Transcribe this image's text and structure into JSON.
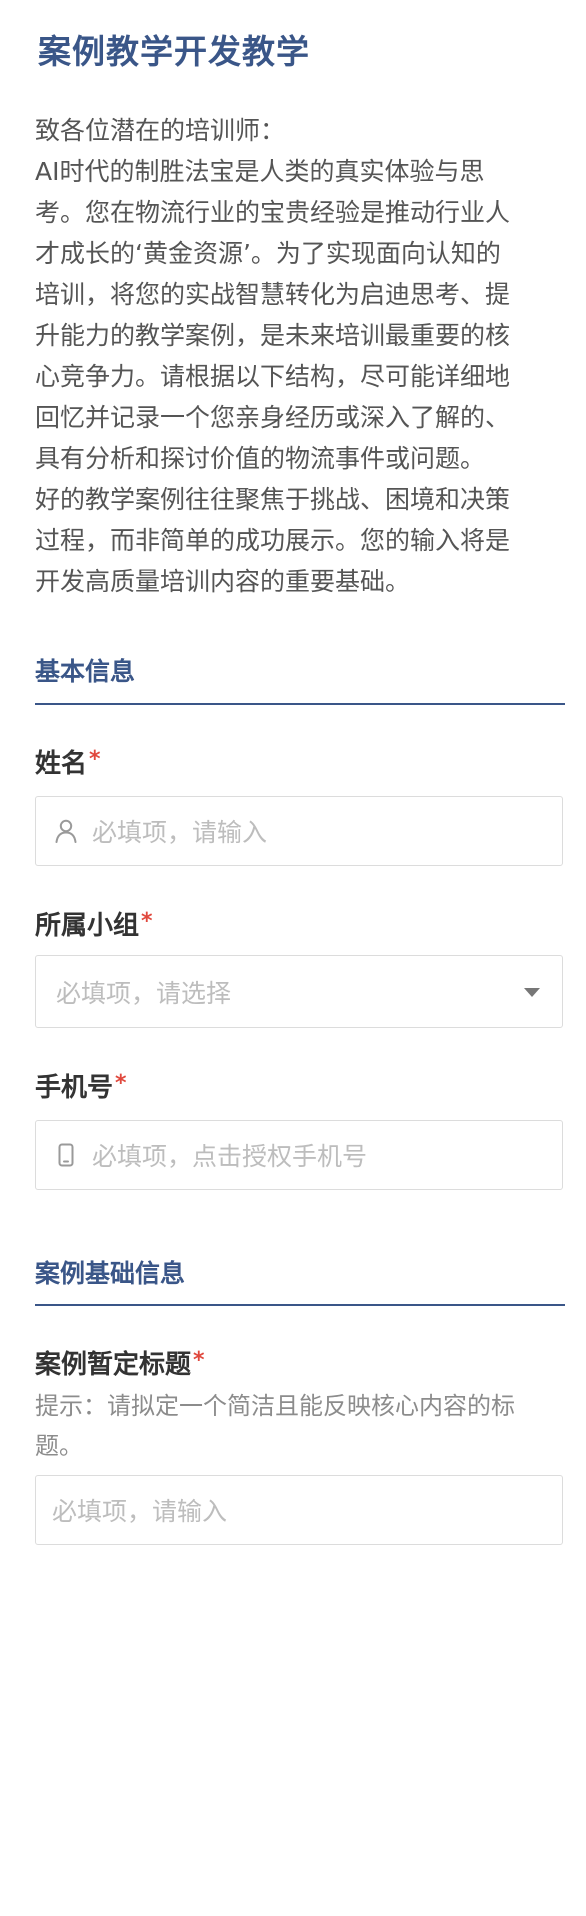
{
  "page": {
    "title": "案例教学开发教学",
    "intro": [
      "致各位潜在的培训师：",
      "AI时代的制胜法宝是人类的真实体验与思考。您在物流行业的宝贵经验是推动行业人才成长的‘黄金资源’。为了实现面向认知的培训，将您的实战智慧转化为启迪思考、提升能力的教学案例，是未来培训最重要的核心竞争力。请根据以下结构，尽可能详细地回忆并记录一个您亲身经历或深入了解的、具有分析和探讨价值的物流事件或问题。",
      "好的教学案例往往聚焦于挑战、困境和决策过程，而非简单的成功展示。您的输入将是开发高质量培训内容的重要基础。"
    ]
  },
  "sections": {
    "basic": {
      "title": "基本信息",
      "name": {
        "label": "姓名",
        "required": "*",
        "placeholder": "必填项，请输入",
        "icon": "user-icon"
      },
      "group": {
        "label": "所属小组",
        "required": "*",
        "placeholder": "必填项，请选择",
        "icon": "chevron-down-icon"
      },
      "phone": {
        "label": "手机号",
        "required": "*",
        "placeholder": "必填项，点击授权手机号",
        "icon": "phone-icon"
      }
    },
    "case": {
      "title": "案例基础信息",
      "case_title": {
        "label": "案例暂定标题",
        "required": "*",
        "hint": "提示：请拟定一个简洁且能反映核心内容的标题。",
        "placeholder": "必填项，请输入"
      }
    }
  },
  "colors": {
    "accent": "#3a5688",
    "required": "#e0483d",
    "placeholder": "#bdbdbd"
  }
}
